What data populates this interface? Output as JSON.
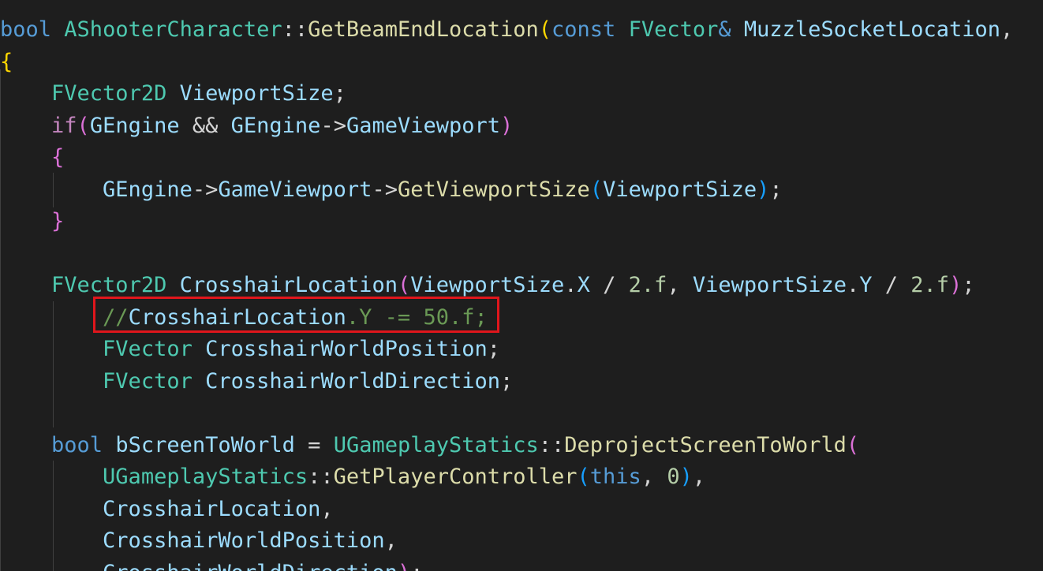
{
  "code_lines": [
    {
      "tokens": [
        {
          "t": "bool",
          "c": "keyword"
        },
        {
          "t": " ",
          "c": "punc"
        },
        {
          "t": "AShooterCharacter",
          "c": "type"
        },
        {
          "t": "::",
          "c": "punc"
        },
        {
          "t": "GetBeamEndLocation",
          "c": "func"
        },
        {
          "t": "(",
          "c": "brace-gold"
        },
        {
          "t": "const",
          "c": "keyword"
        },
        {
          "t": " ",
          "c": "punc"
        },
        {
          "t": "FVector",
          "c": "type"
        },
        {
          "t": "&",
          "c": "keyword"
        },
        {
          "t": " ",
          "c": "punc"
        },
        {
          "t": "MuzzleSocketLocation",
          "c": "var"
        },
        {
          "t": ",",
          "c": "punc"
        }
      ]
    },
    {
      "tokens": [
        {
          "t": "{",
          "c": "brace-gold"
        }
      ]
    },
    {
      "tokens": [
        {
          "t": "    ",
          "c": "punc"
        },
        {
          "t": "FVector2D",
          "c": "type"
        },
        {
          "t": " ",
          "c": "punc"
        },
        {
          "t": "ViewportSize",
          "c": "var"
        },
        {
          "t": ";",
          "c": "punc"
        }
      ]
    },
    {
      "tokens": [
        {
          "t": "    ",
          "c": "punc"
        },
        {
          "t": "if",
          "c": "control"
        },
        {
          "t": "(",
          "c": "brace-pink"
        },
        {
          "t": "GEngine",
          "c": "var"
        },
        {
          "t": " && ",
          "c": "punc"
        },
        {
          "t": "GEngine",
          "c": "var"
        },
        {
          "t": "->",
          "c": "punc"
        },
        {
          "t": "GameViewport",
          "c": "var"
        },
        {
          "t": ")",
          "c": "brace-pink"
        }
      ]
    },
    {
      "tokens": [
        {
          "t": "    ",
          "c": "punc"
        },
        {
          "t": "{",
          "c": "brace-pink"
        }
      ]
    },
    {
      "tokens": [
        {
          "t": "        ",
          "c": "punc"
        },
        {
          "t": "GEngine",
          "c": "var"
        },
        {
          "t": "->",
          "c": "punc"
        },
        {
          "t": "GameViewport",
          "c": "var"
        },
        {
          "t": "->",
          "c": "punc"
        },
        {
          "t": "GetViewportSize",
          "c": "func"
        },
        {
          "t": "(",
          "c": "brace-blue"
        },
        {
          "t": "ViewportSize",
          "c": "var"
        },
        {
          "t": ")",
          "c": "brace-blue"
        },
        {
          "t": ";",
          "c": "punc"
        }
      ]
    },
    {
      "tokens": [
        {
          "t": "    ",
          "c": "punc"
        },
        {
          "t": "}",
          "c": "brace-pink"
        }
      ]
    },
    {
      "tokens": []
    },
    {
      "tokens": [
        {
          "t": "    ",
          "c": "punc"
        },
        {
          "t": "FVector2D",
          "c": "type"
        },
        {
          "t": " ",
          "c": "punc"
        },
        {
          "t": "CrosshairLocation",
          "c": "var"
        },
        {
          "t": "(",
          "c": "brace-pink"
        },
        {
          "t": "ViewportSize",
          "c": "var"
        },
        {
          "t": ".",
          "c": "punc"
        },
        {
          "t": "X",
          "c": "var"
        },
        {
          "t": " / ",
          "c": "punc"
        },
        {
          "t": "2.f",
          "c": "num"
        },
        {
          "t": ", ",
          "c": "punc"
        },
        {
          "t": "ViewportSize",
          "c": "var"
        },
        {
          "t": ".",
          "c": "punc"
        },
        {
          "t": "Y",
          "c": "var"
        },
        {
          "t": " / ",
          "c": "punc"
        },
        {
          "t": "2.f",
          "c": "num"
        },
        {
          "t": ")",
          "c": "brace-pink"
        },
        {
          "t": ";",
          "c": "punc"
        }
      ]
    },
    {
      "tokens": [
        {
          "t": "        ",
          "c": "punc"
        },
        {
          "t": "//",
          "c": "comment"
        },
        {
          "t": "CrosshairLocation",
          "c": "var"
        },
        {
          "t": ".Y -= 50.f;",
          "c": "comment"
        }
      ]
    },
    {
      "tokens": [
        {
          "t": "        ",
          "c": "punc"
        },
        {
          "t": "FVector",
          "c": "type"
        },
        {
          "t": " ",
          "c": "punc"
        },
        {
          "t": "CrosshairWorldPosition",
          "c": "var"
        },
        {
          "t": ";",
          "c": "punc"
        }
      ]
    },
    {
      "tokens": [
        {
          "t": "        ",
          "c": "punc"
        },
        {
          "t": "FVector",
          "c": "type"
        },
        {
          "t": " ",
          "c": "punc"
        },
        {
          "t": "CrosshairWorldDirection",
          "c": "var"
        },
        {
          "t": ";",
          "c": "punc"
        }
      ]
    },
    {
      "tokens": []
    },
    {
      "tokens": [
        {
          "t": "    ",
          "c": "punc"
        },
        {
          "t": "bool",
          "c": "keyword"
        },
        {
          "t": " ",
          "c": "punc"
        },
        {
          "t": "bScreenToWorld",
          "c": "var"
        },
        {
          "t": " = ",
          "c": "punc"
        },
        {
          "t": "UGameplayStatics",
          "c": "type"
        },
        {
          "t": "::",
          "c": "punc"
        },
        {
          "t": "DeprojectScreenToWorld",
          "c": "func"
        },
        {
          "t": "(",
          "c": "brace-pink"
        }
      ]
    },
    {
      "tokens": [
        {
          "t": "        ",
          "c": "punc"
        },
        {
          "t": "UGameplayStatics",
          "c": "type"
        },
        {
          "t": "::",
          "c": "punc"
        },
        {
          "t": "GetPlayerController",
          "c": "func"
        },
        {
          "t": "(",
          "c": "brace-blue"
        },
        {
          "t": "this",
          "c": "keyword"
        },
        {
          "t": ", ",
          "c": "punc"
        },
        {
          "t": "0",
          "c": "num"
        },
        {
          "t": ")",
          "c": "brace-blue"
        },
        {
          "t": ",",
          "c": "punc"
        }
      ]
    },
    {
      "tokens": [
        {
          "t": "        ",
          "c": "punc"
        },
        {
          "t": "CrosshairLocation",
          "c": "var"
        },
        {
          "t": ",",
          "c": "punc"
        }
      ]
    },
    {
      "tokens": [
        {
          "t": "        ",
          "c": "punc"
        },
        {
          "t": "CrosshairWorldPosition",
          "c": "var"
        },
        {
          "t": ",",
          "c": "punc"
        }
      ]
    },
    {
      "tokens": [
        {
          "t": "        ",
          "c": "punc"
        },
        {
          "t": "CrosshairWorldDirection",
          "c": "var"
        },
        {
          "t": ")",
          "c": "brace-pink"
        },
        {
          "t": ";",
          "c": "punc"
        }
      ]
    }
  ],
  "theme": {
    "background": "#1e1e1e",
    "keyword": "#569cd6",
    "control": "#c586c0",
    "type": "#4ec9b0",
    "function": "#dcdcaa",
    "variable": "#9cdcfe",
    "number": "#b5cea8",
    "comment": "#6a9955",
    "highlight_border": "#e0161c"
  }
}
